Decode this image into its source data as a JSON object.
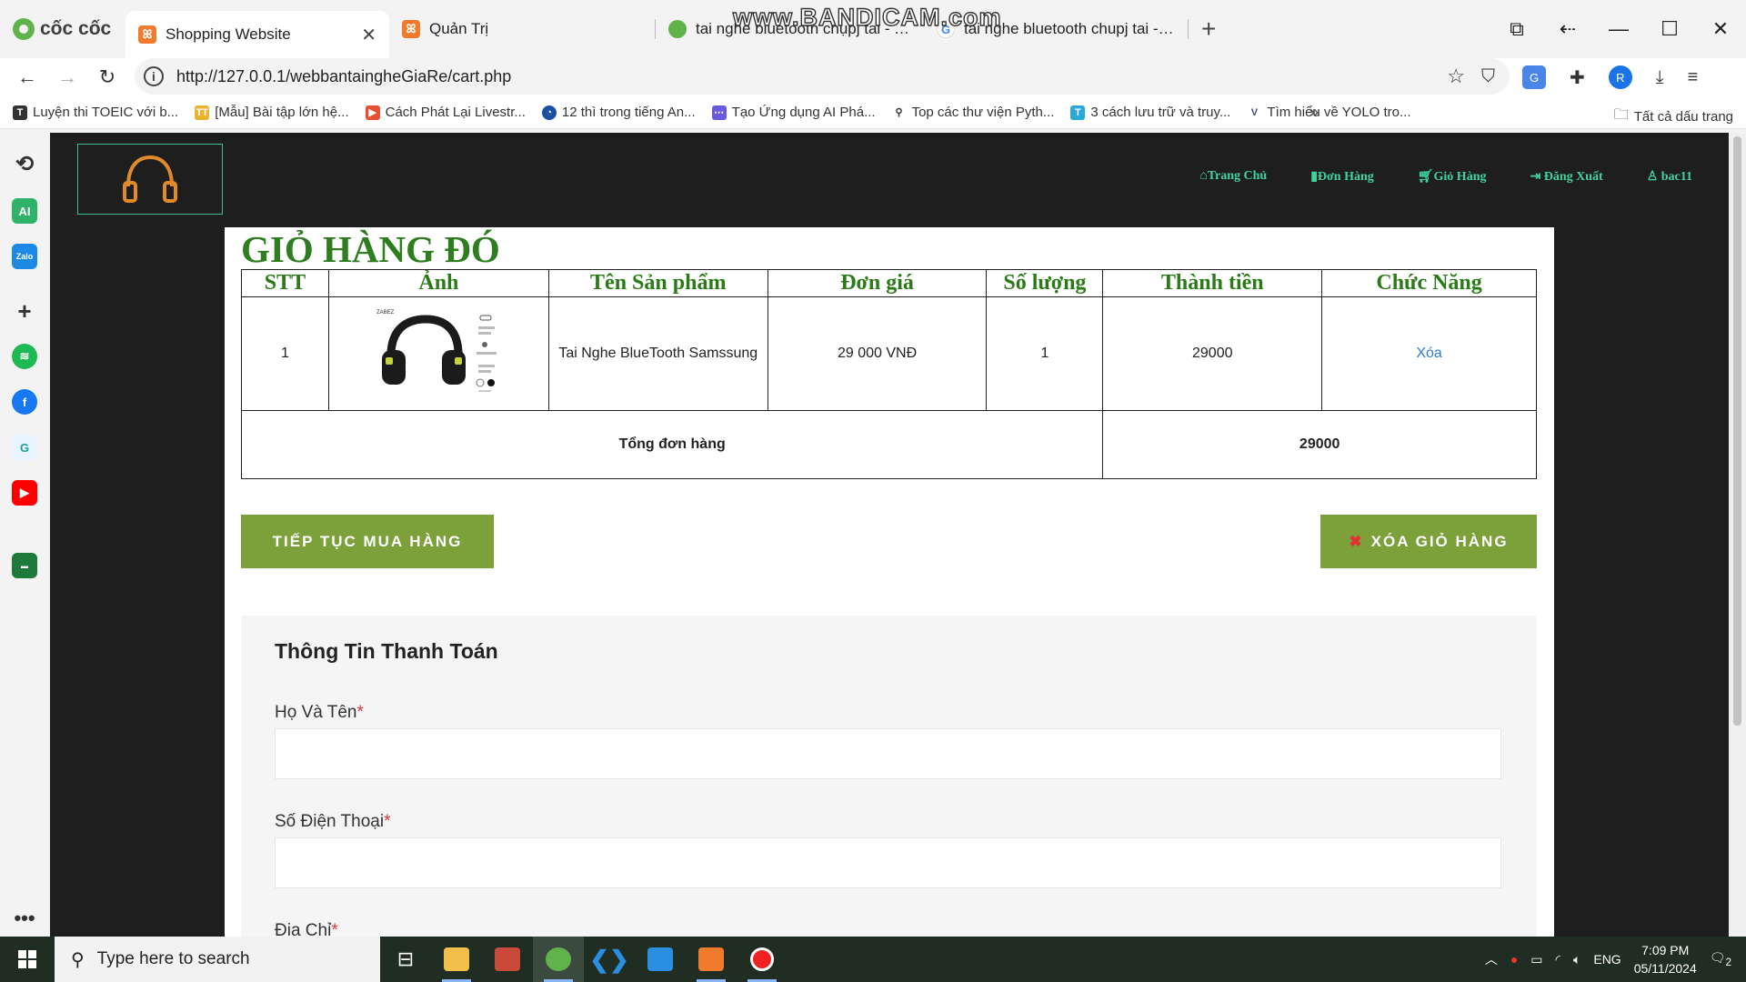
{
  "browser": {
    "brand": "cốc cốc",
    "tabs": [
      {
        "label": "Shopping Website",
        "active": true
      },
      {
        "label": "Quản Trị"
      },
      {
        "label": "tai nghe bluetooth chụpj tai - Tìm"
      },
      {
        "label": "tai nghe bluetooth chupj tai - Goo"
      }
    ],
    "watermark": "www.BANDICAM.com",
    "url": "http://127.0.0.1/webbantaingheGiaRe/cart.php",
    "profile_initial": "R",
    "bookmarks": [
      "Luyện thi TOEIC với b...",
      "[Mẫu] Bài tập lớn hệ...",
      "Cách Phát Lại Livestr...",
      "12 thì trong tiếng An...",
      "Tạo Ứng dụng AI Phá...",
      "Top các thư viện Pyth...",
      "3 cách lưu trữ và truy...",
      "Tìm hiểu về YOLO tro..."
    ],
    "all_bookmarks": "Tất cả dấu trang"
  },
  "site": {
    "nav": {
      "home": "Trang Chủ",
      "orders": "Đơn Hàng",
      "cart": "Giỏ Hàng",
      "logout": "Đăng Xuất",
      "user": "bac11"
    },
    "cart_title": "GIỎ HÀNG ĐÓ",
    "table": {
      "headers": [
        "STT",
        "Ảnh",
        "Tên Sản phẩm",
        "Đơn giá",
        "Số lượng",
        "Thành tiền",
        "Chức Năng"
      ],
      "rows": [
        {
          "stt": "1",
          "name": "Tai Nghe BlueTooth Samssung",
          "price": "29 000 VNĐ",
          "qty": "1",
          "total": "29000",
          "action": "Xóa"
        }
      ],
      "total_label": "Tổng đơn hàng",
      "total_value": "29000"
    },
    "product_image": {
      "brand": "ZABEZ"
    },
    "continue_button": "TIẾP TỤC MUA HÀNG",
    "clear_button": "XÓA GIỎ HÀNG",
    "checkout": {
      "title": "Thông Tin Thanh Toán",
      "fields": [
        "Họ Và Tên",
        "Số Điện Thoại",
        "Địa Chỉ"
      ],
      "required_mark": "*"
    }
  },
  "taskbar": {
    "search_placeholder": "Type here to search",
    "language": "ENG",
    "time": "7:09 PM",
    "date": "05/11/2024",
    "notifications": "2"
  },
  "colors": {
    "site_bg": "#1e1e1e",
    "nav_link": "#41d39e",
    "title_green": "#2e7d1f",
    "button_green": "#7ca03a",
    "link_blue": "#2b7bd0"
  }
}
